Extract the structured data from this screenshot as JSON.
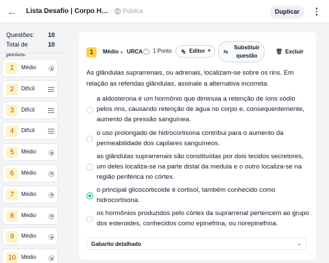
{
  "header": {
    "title": "Lista Desafio | Corpo Huma...",
    "visibility": "Pública",
    "duplicate_label": "Duplicar"
  },
  "summary": {
    "questions_label": "Questões:",
    "questions_value": "10",
    "points_label": "Total de pontos:",
    "points_value": "10"
  },
  "question_list": [
    {
      "number": "1",
      "difficulty": "Médio",
      "type": "radio-icon"
    },
    {
      "number": "2",
      "difficulty": "Difícil",
      "type": "text-lines-icon"
    },
    {
      "number": "3",
      "difficulty": "Difícil",
      "type": "text-lines-icon"
    },
    {
      "number": "4",
      "difficulty": "Difícil",
      "type": "text-lines-icon"
    },
    {
      "number": "5",
      "difficulty": "Médio",
      "type": "radio-icon"
    },
    {
      "number": "6",
      "difficulty": "Médio",
      "type": "radio-icon"
    },
    {
      "number": "7",
      "difficulty": "Médio",
      "type": "radio-icon"
    },
    {
      "number": "8",
      "difficulty": "Médio",
      "type": "radio-icon"
    },
    {
      "number": "9",
      "difficulty": "Médio",
      "type": "radio-icon"
    },
    {
      "number": "10",
      "difficulty": "Médio",
      "type": "radio-icon"
    }
  ],
  "question": {
    "number": "1",
    "difficulty": "Médio",
    "separator": "•",
    "source": "URCA",
    "points": "1 Ponto",
    "editor_label": "Editor",
    "substitute_label": "Substituir questão",
    "delete_label": "Excluir",
    "statement": "As glândulas suprarrenais, ou adrenais, localizam-se sobre os rins. Em relação as referidas glândulas, assinale a alternativa incorreta.",
    "options": [
      {
        "text": "a aldosterona é um hormônio que diminuia a retenção de íons sódio pelos rins, causando retenção de água no corpo e, consequentemente, aumento da pressão sanguínea.",
        "selected": false
      },
      {
        "text": "o uso prolongado de hidrocortisona contribui para o aumento da permeabilidade dos capilares sanguíneos.",
        "selected": false
      },
      {
        "text": "as glândulas suprarrenais são constituídas por dois tecidos secretores, um deles localiza-se na parte distal da medula e o outro localiza-se na região periférica no córtex.",
        "selected": false
      },
      {
        "text": "o principal glicocorticoide é cortisol, também conhecido como hidrocortisona.",
        "selected": true
      },
      {
        "text": "os hormônios produzidos pelo córtex da suprarrenal pertencem ao grupo dos esteroides, conhecidos como epinefrina, ou norepinefrina.",
        "selected": false
      }
    ],
    "explanation_label": "Gabarito detalhado"
  },
  "colors": {
    "accent": "#4f46e5",
    "badge_bg": "#fef3c7",
    "selected": "#10b981"
  }
}
